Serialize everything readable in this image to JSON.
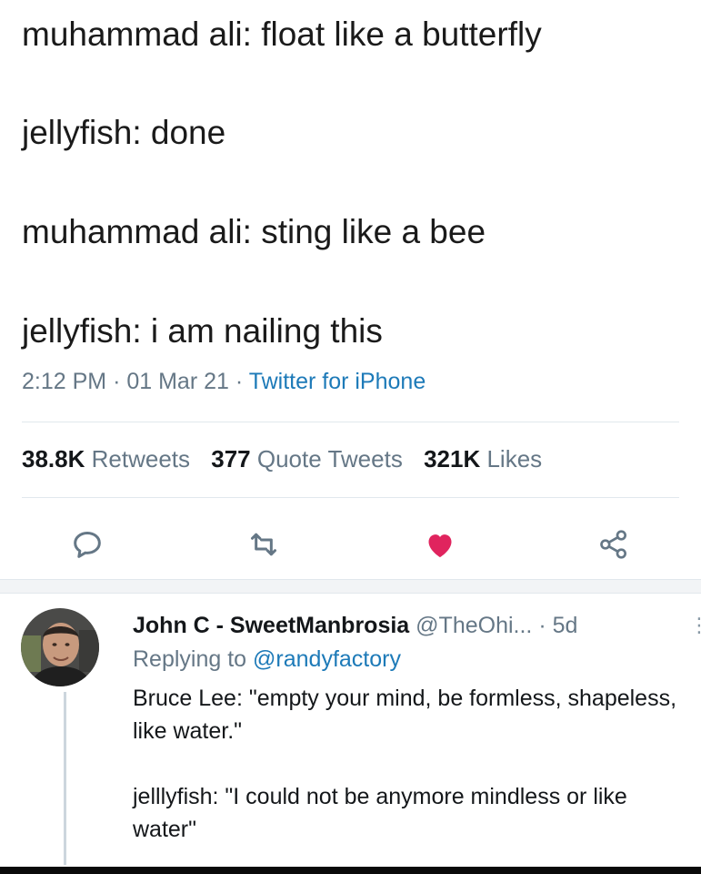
{
  "tweet": {
    "lines": [
      "muhammad ali: float like a butterfly",
      "jellyfish: done",
      "muhammad ali: sting like a bee",
      "jellyfish: i am nailing this"
    ],
    "time": "2:12 PM",
    "date": "01 Mar 21",
    "source": "Twitter for iPhone",
    "separator": "·"
  },
  "stats": {
    "retweets_count": "38.8K",
    "retweets_label": "Retweets",
    "quotes_count": "377",
    "quotes_label": "Quote Tweets",
    "likes_count": "321K",
    "likes_label": "Likes"
  },
  "actions": {
    "reply_icon": "reply-icon",
    "retweet_icon": "retweet-icon",
    "like_icon": "heart-icon",
    "share_icon": "share-icon",
    "like_color": "#e0245e"
  },
  "reply": {
    "display_name": "John C - SweetManbrosia",
    "handle": "@TheOhi...",
    "time_sep": "·",
    "time": "5d",
    "more": "⋮",
    "replying_prefix": "Replying to",
    "replying_handle": "@randyfactory",
    "text": "Bruce Lee: \"empty your mind, be formless, shapeless, like water.\"\n\njelllyfish: \"I could not  be anymore mindless or like water\""
  },
  "colors": {
    "text": "#14171a",
    "secondary": "#657786",
    "link": "#1d7ab8",
    "divider": "#e1e8ed"
  }
}
